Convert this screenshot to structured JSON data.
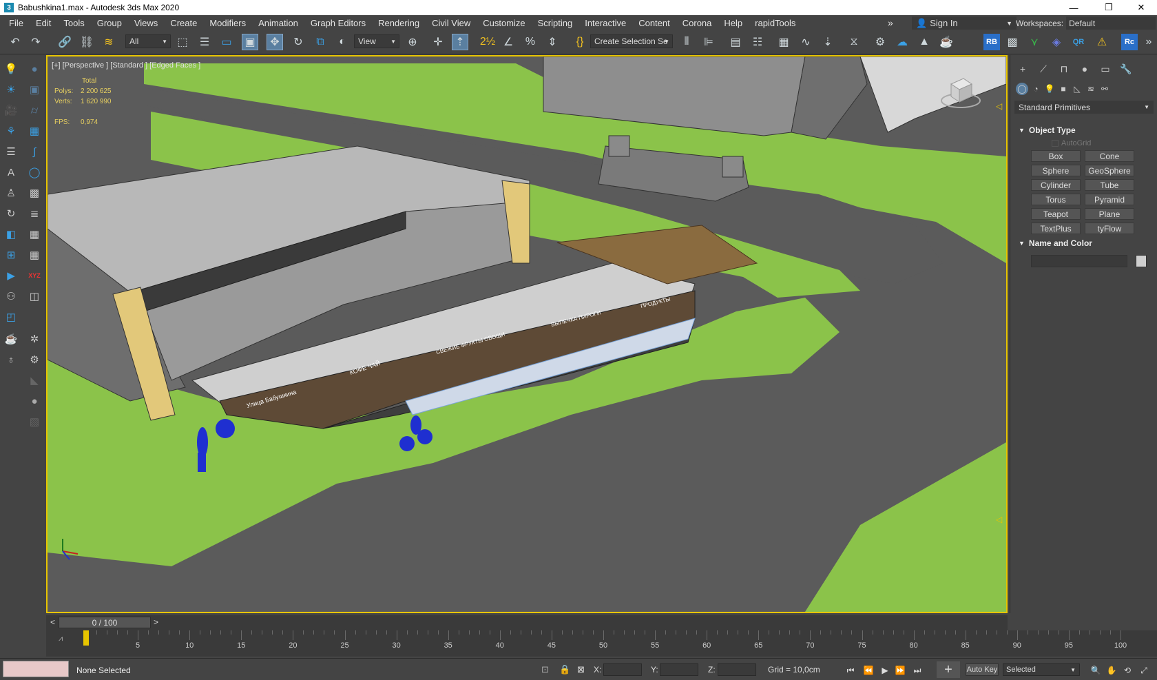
{
  "window": {
    "title": "Babushkina1.max - Autodesk 3ds Max 2020",
    "minimize": "—",
    "restore": "❐",
    "close": "✕"
  },
  "menu": [
    "File",
    "Edit",
    "Tools",
    "Group",
    "Views",
    "Create",
    "Modifiers",
    "Animation",
    "Graph Editors",
    "Rendering",
    "Civil View",
    "Customize",
    "Scripting",
    "Interactive",
    "Content",
    "Corona",
    "Help",
    "rapidTools"
  ],
  "menu_overflow": "»",
  "signin": {
    "label": "Sign In"
  },
  "workspaces": {
    "label": "Workspaces:",
    "value": "Default"
  },
  "toolbar": {
    "selection_filter": "All",
    "ref_coord": "View",
    "named_selection": "Create Selection Se",
    "rb_badge": "RB",
    "qr_badge": "QR",
    "rc_badge": "Rc"
  },
  "viewport": {
    "label": "[+] [Perspective ] [Standard ] [Edged Faces ]",
    "stats": {
      "header": "Total",
      "polys_label": "Polys:",
      "polys_value": "2 200 625",
      "verts_label": "Verts:",
      "verts_value": "1 620 990",
      "fps_label": "FPS:",
      "fps_value": "0,974"
    },
    "signs": [
      "Улица Бабушкина",
      "КОФЕ ЧАЙ",
      "СВЕЖИЕ ФРУКТЫ ОВОЩИ",
      "ВЫПЕЧКА ПИРОГИ",
      "ПРОДУКТЫ"
    ]
  },
  "command_panel": {
    "category": "Standard Primitives",
    "object_type": {
      "title": "Object Type",
      "autogrid": "AutoGrid",
      "buttons": [
        "Box",
        "Cone",
        "Sphere",
        "GeoSphere",
        "Cylinder",
        "Tube",
        "Torus",
        "Pyramid",
        "Teapot",
        "Plane",
        "TextPlus",
        "tyFlow"
      ]
    },
    "name_color": {
      "title": "Name and Color"
    }
  },
  "timeline": {
    "slider_label": "0 / 100",
    "prev": "<",
    "next": ">",
    "ticks": [
      "5",
      "10",
      "15",
      "20",
      "25",
      "30",
      "35",
      "40",
      "45",
      "50",
      "55",
      "60",
      "65",
      "70",
      "75",
      "80",
      "85",
      "90",
      "95",
      "100"
    ]
  },
  "status": {
    "selection": "None Selected",
    "x_label": "X:",
    "y_label": "Y:",
    "z_label": "Z:",
    "grid": "Grid = 10,0cm",
    "autokey": "Auto Key",
    "key_filter": "Selected"
  },
  "colors": {
    "viewport_border": "#e8c500",
    "grass": "#8bc34a",
    "road": "#5b5b5b",
    "panel": "#444444"
  }
}
